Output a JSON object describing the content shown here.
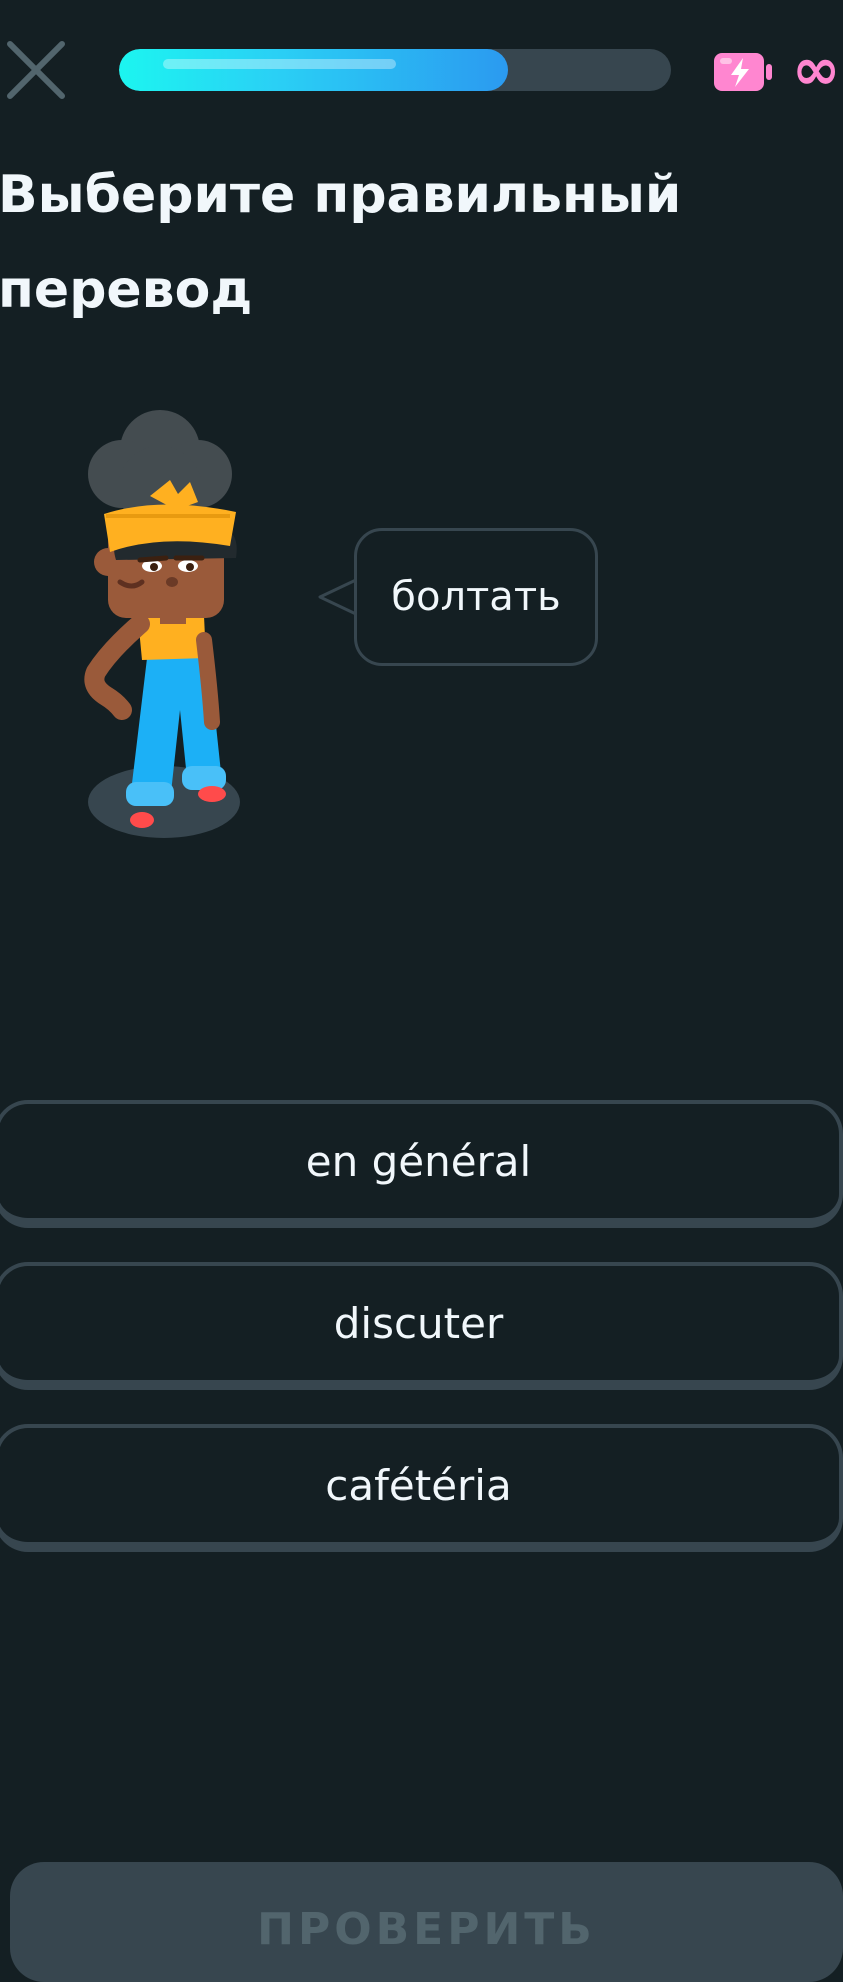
{
  "header": {
    "close_icon": "close-icon",
    "progress": 0.705,
    "energy_icon": "battery-lightning-icon",
    "energy_value": "∞",
    "accent": "#1cf5f0",
    "energy_color": "#ff86d0"
  },
  "prompt": {
    "title": "Выберите правильный перевод"
  },
  "speech": {
    "word": "болтать"
  },
  "choices": [
    {
      "label": "en général"
    },
    {
      "label": "discuter"
    },
    {
      "label": "cafétéria"
    }
  ],
  "footer": {
    "check_label": "ПРОВЕРИТЬ"
  }
}
